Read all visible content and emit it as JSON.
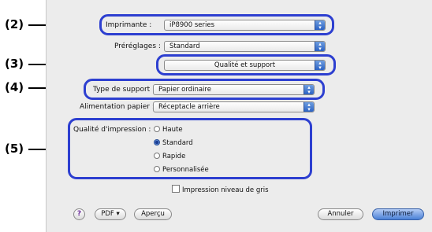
{
  "callouts": [
    "(2)",
    "(3)",
    "(4)",
    "(5)"
  ],
  "printer": {
    "label": "Imprimante :",
    "value": "iP8900 series"
  },
  "presets": {
    "label": "Préréglages :",
    "value": "Standard"
  },
  "panel": {
    "value": "Qualité et support"
  },
  "media_type": {
    "label": "Type de support :",
    "value": "Papier ordinaire"
  },
  "paper_source": {
    "label": "Alimentation papier :",
    "value": "Réceptacle arrière"
  },
  "print_quality": {
    "label": "Qualité d'impression :",
    "options": [
      "Haute",
      "Standard",
      "Rapide",
      "Personnalisée"
    ],
    "selected": "Standard"
  },
  "grayscale": {
    "label": "Impression niveau de gris",
    "checked": false
  },
  "footer": {
    "help_label": "?",
    "pdf_label": "PDF ▾",
    "preview_label": "Aperçu",
    "cancel_label": "Annuler",
    "print_label": "Imprimer"
  },
  "colors": {
    "highlight": "#2d3fd0",
    "default_button": "#4a80d6"
  }
}
